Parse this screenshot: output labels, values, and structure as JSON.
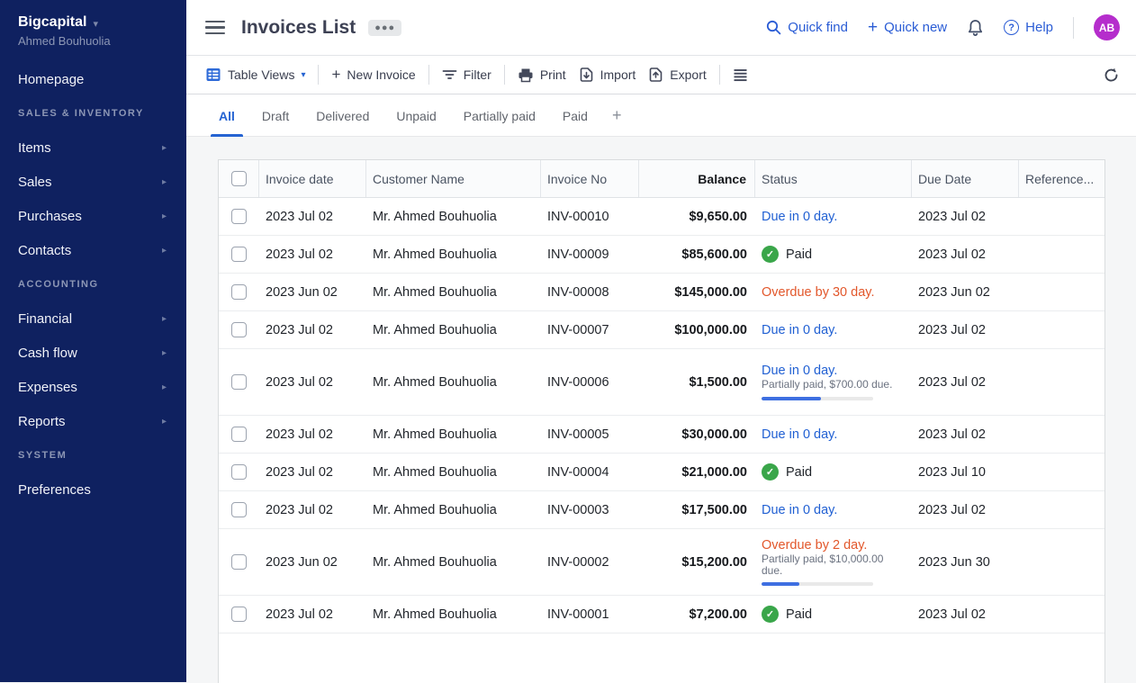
{
  "sidebar": {
    "brand": "Bigcapital",
    "user": "Ahmed Bouhuolia",
    "items": [
      {
        "label": "Homepage",
        "type": "link",
        "arrow": false
      },
      {
        "label": "SALES & INVENTORY",
        "type": "section"
      },
      {
        "label": "Items",
        "type": "link",
        "arrow": true
      },
      {
        "label": "Sales",
        "type": "link",
        "arrow": true
      },
      {
        "label": "Purchases",
        "type": "link",
        "arrow": true
      },
      {
        "label": "Contacts",
        "type": "link",
        "arrow": true
      },
      {
        "label": "ACCOUNTING",
        "type": "section"
      },
      {
        "label": "Financial",
        "type": "link",
        "arrow": true
      },
      {
        "label": "Cash flow",
        "type": "link",
        "arrow": true
      },
      {
        "label": "Expenses",
        "type": "link",
        "arrow": true
      },
      {
        "label": "Reports",
        "type": "link",
        "arrow": true
      },
      {
        "label": "SYSTEM",
        "type": "section"
      },
      {
        "label": "Preferences",
        "type": "link",
        "arrow": false
      }
    ]
  },
  "topbar": {
    "title": "Invoices List",
    "quick_find": "Quick find",
    "quick_new": "Quick new",
    "help": "Help",
    "help_qmark": "?",
    "avatar_initials": "AB"
  },
  "toolbar": {
    "table_views": "Table Views",
    "new_invoice": "New Invoice",
    "filter": "Filter",
    "print": "Print",
    "import": "Import",
    "export": "Export"
  },
  "tabs": {
    "active": "All",
    "items": [
      "All",
      "Draft",
      "Delivered",
      "Unpaid",
      "Partially paid",
      "Paid"
    ]
  },
  "table": {
    "columns": [
      "",
      "Invoice date",
      "Customer Name",
      "Invoice No",
      "Balance",
      "Status",
      "Due Date",
      "Reference..."
    ],
    "rows": [
      {
        "date": "2023 Jul 02",
        "customer": "Mr. Ahmed Bouhuolia",
        "invoice_no": "INV-00010",
        "balance": "$9,650.00",
        "status": "Due in 0 day.",
        "status_type": "due",
        "due_date": "2023 Jul 02",
        "reference": ""
      },
      {
        "date": "2023 Jul 02",
        "customer": "Mr. Ahmed Bouhuolia",
        "invoice_no": "INV-00009",
        "balance": "$85,600.00",
        "status": "Paid",
        "status_type": "paid",
        "due_date": "2023 Jul 02",
        "reference": ""
      },
      {
        "date": "2023 Jun 02",
        "customer": "Mr. Ahmed Bouhuolia",
        "invoice_no": "INV-00008",
        "balance": "$145,000.00",
        "status": "Overdue by 30 day.",
        "status_type": "overdue",
        "due_date": "2023 Jun 02",
        "reference": ""
      },
      {
        "date": "2023 Jul 02",
        "customer": "Mr. Ahmed Bouhuolia",
        "invoice_no": "INV-00007",
        "balance": "$100,000.00",
        "status": "Due in 0 day.",
        "status_type": "due",
        "due_date": "2023 Jul 02",
        "reference": ""
      },
      {
        "date": "2023 Jul 02",
        "customer": "Mr. Ahmed Bouhuolia",
        "invoice_no": "INV-00006",
        "balance": "$1,500.00",
        "status": "Due in 0 day.",
        "status_type": "due",
        "due_date": "2023 Jul 02",
        "reference": "",
        "substatus": "Partially paid, $700.00 due.",
        "progress_percent": 53
      },
      {
        "date": "2023 Jul 02",
        "customer": "Mr. Ahmed Bouhuolia",
        "invoice_no": "INV-00005",
        "balance": "$30,000.00",
        "status": "Due in 0 day.",
        "status_type": "due",
        "due_date": "2023 Jul 02",
        "reference": ""
      },
      {
        "date": "2023 Jul 02",
        "customer": "Mr. Ahmed Bouhuolia",
        "invoice_no": "INV-00004",
        "balance": "$21,000.00",
        "status": "Paid",
        "status_type": "paid",
        "due_date": "2023 Jul 10",
        "reference": ""
      },
      {
        "date": "2023 Jul 02",
        "customer": "Mr. Ahmed Bouhuolia",
        "invoice_no": "INV-00003",
        "balance": "$17,500.00",
        "status": "Due in 0 day.",
        "status_type": "due",
        "due_date": "2023 Jul 02",
        "reference": ""
      },
      {
        "date": "2023 Jun 02",
        "customer": "Mr. Ahmed Bouhuolia",
        "invoice_no": "INV-00002",
        "balance": "$15,200.00",
        "status": "Overdue by 2 day.",
        "status_type": "overdue",
        "due_date": "2023 Jun 30",
        "reference": "",
        "substatus": "Partially paid, $10,000.00 due.",
        "progress_percent": 34
      },
      {
        "date": "2023 Jul 02",
        "customer": "Mr. Ahmed Bouhuolia",
        "invoice_no": "INV-00001",
        "balance": "$7,200.00",
        "status": "Paid",
        "status_type": "paid",
        "due_date": "2023 Jul 02",
        "reference": ""
      }
    ]
  },
  "colors": {
    "sidebar_navy": "#0f2160",
    "accent_blue": "#2563d2",
    "overdue_orange": "#e2572b",
    "paid_green": "#3aa64a",
    "avatar_purple": "#b52dcc"
  },
  "icons": {
    "paid_check": "✓"
  }
}
